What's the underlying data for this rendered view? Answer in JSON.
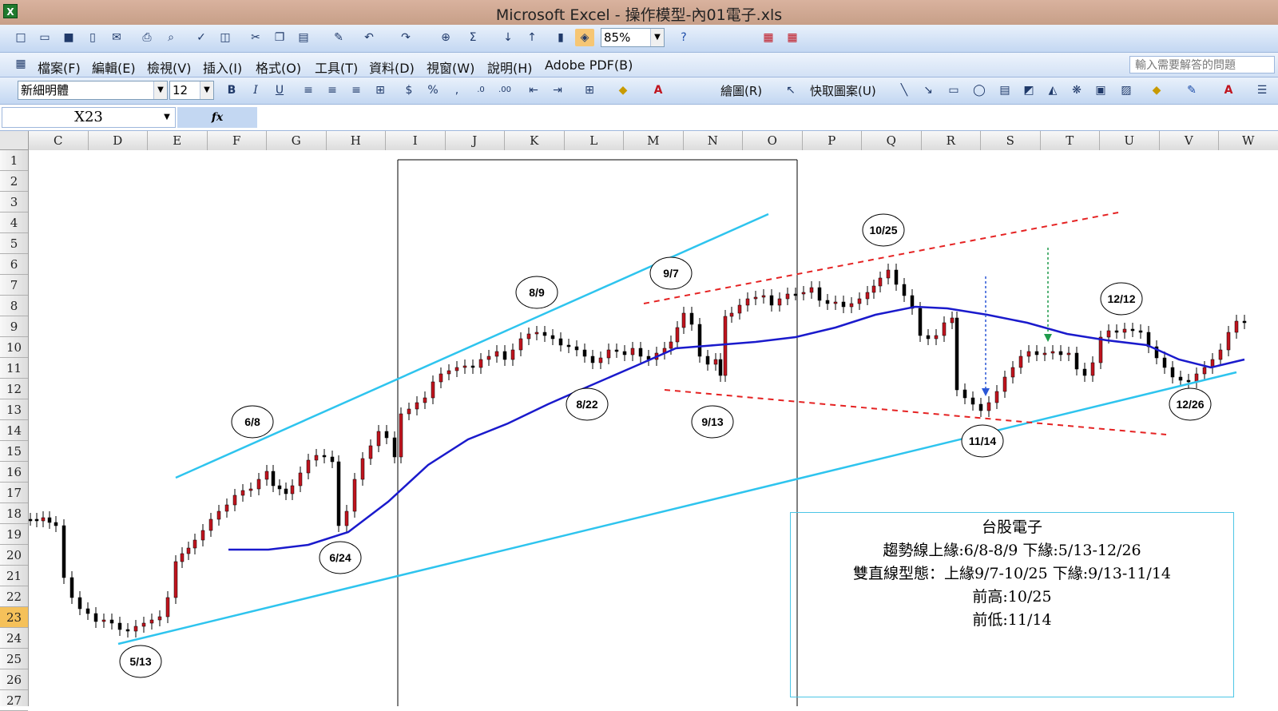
{
  "window": {
    "title": "Microsoft Excel - 操作模型-內01電子.xls",
    "app_icon": "X"
  },
  "toolbar": {
    "zoom": "85%",
    "font_name": "新細明體",
    "font_size": "12",
    "help_placeholder": "輸入需要解答的問題"
  },
  "menu": [
    {
      "label": "檔案(F)"
    },
    {
      "label": "編輯(E)"
    },
    {
      "label": "檢視(V)"
    },
    {
      "label": "插入(I)"
    },
    {
      "label": "格式(O)"
    },
    {
      "label": "工具(T)"
    },
    {
      "label": "資料(D)"
    },
    {
      "label": "視窗(W)"
    },
    {
      "label": "說明(H)"
    },
    {
      "label": "Adobe PDF(B)"
    }
  ],
  "drawing": {
    "draw_label": "繪圖(R)",
    "autoshape_label": "快取圖案(U)"
  },
  "formula": {
    "cell_ref": "X23",
    "fx": "fx"
  },
  "columns": [
    "C",
    "D",
    "E",
    "F",
    "G",
    "H",
    "I",
    "J",
    "K",
    "L",
    "M",
    "N",
    "O",
    "P",
    "Q",
    "R",
    "S",
    "T",
    "U",
    "V",
    "W"
  ],
  "rows": [
    "1",
    "2",
    "3",
    "4",
    "5",
    "6",
    "7",
    "8",
    "9",
    "10",
    "11",
    "12",
    "13",
    "14",
    "15",
    "16",
    "17",
    "18",
    "19",
    "20",
    "21",
    "22",
    "23",
    "24",
    "25",
    "26",
    "27"
  ],
  "selected_row": "23",
  "annotations": {
    "labels": [
      "5/13",
      "6/8",
      "6/24",
      "8/9",
      "8/22",
      "9/7",
      "9/13",
      "10/25",
      "11/14",
      "12/12",
      "12/26"
    ],
    "info": [
      "台股電子",
      "趨勢線上緣:6/8-8/9 下緣:5/13-12/26",
      "雙直線型態：上緣9/7-10/25 下緣:9/13-11/14",
      "前高:10/25",
      "前低:11/14"
    ]
  },
  "colors": {
    "trendline": "#2ec4ee",
    "channel": "#e52222",
    "moving_average": "#1a1acc",
    "candle_up": "#c0141e",
    "candle_down": "#000000"
  }
}
